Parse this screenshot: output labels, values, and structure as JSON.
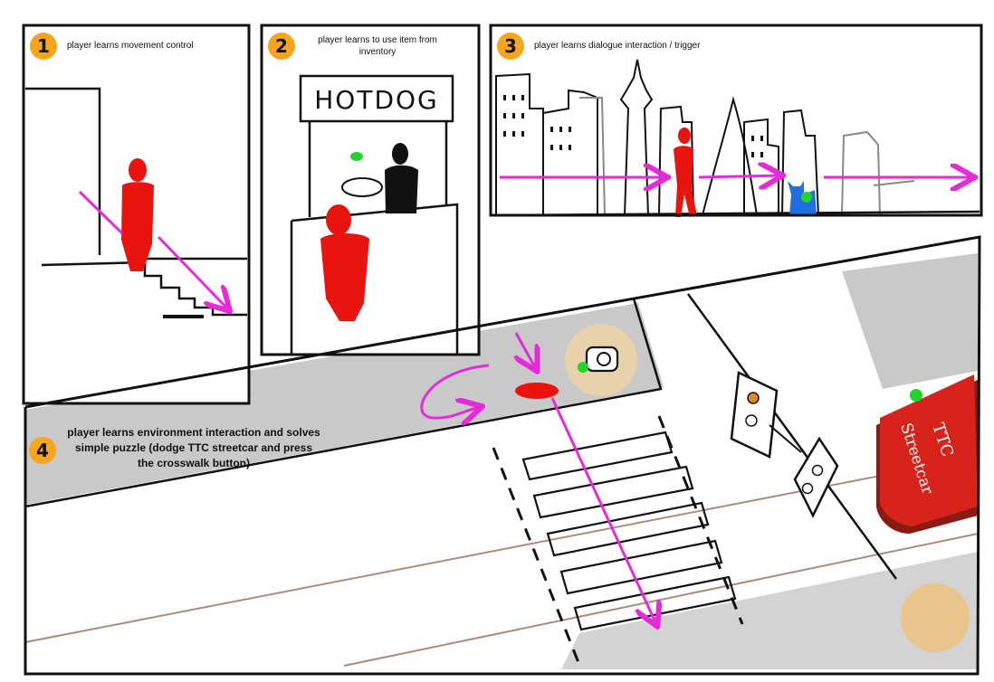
{
  "panels": [
    {
      "number": "1",
      "caption": "player learns movement control"
    },
    {
      "number": "2",
      "caption": "player learns to use item from inventory"
    },
    {
      "number": "3",
      "caption": "player learns dialogue interaction / trigger"
    },
    {
      "number": "4",
      "caption": "player learns environment interaction and solves simple puzzle (dodge TTC streetcar and press the crosswalk button)"
    }
  ],
  "signs": {
    "hotdog": "HOTDOG",
    "streetcar_line1": "TTC",
    "streetcar_line2": "Streetcar"
  },
  "colors": {
    "player": "#e8140d",
    "arrow": "#e62ad8",
    "interactable_marker": "#22d32c",
    "badge": "#f7a51c",
    "sidewalk": "#c9c9c9",
    "streetcar": "#d7231a",
    "cat": "#1f6fe0",
    "button_glow": "#ecd3a6",
    "track": "#a88c7c"
  }
}
